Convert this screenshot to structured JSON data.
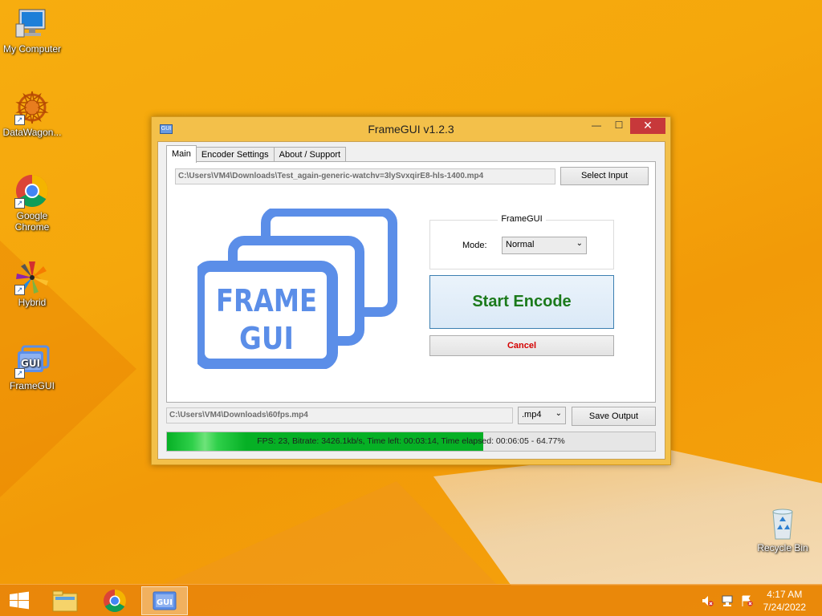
{
  "desktop": {
    "icons": [
      {
        "label": "My Computer"
      },
      {
        "label": "DataWagon..."
      },
      {
        "label": "Google Chrome"
      },
      {
        "label": "Hybrid"
      },
      {
        "label": "FrameGUI"
      },
      {
        "label": "Recycle Bin"
      }
    ]
  },
  "window": {
    "title": "FrameGUI v1.2.3",
    "icon_text": "GUI",
    "minimize": "—",
    "maximize": "☐",
    "close": "✕",
    "tabs": [
      {
        "label": "Main",
        "active": true
      },
      {
        "label": "Encoder Settings",
        "active": false
      },
      {
        "label": "About / Support",
        "active": false
      }
    ],
    "input_path": "C:\\Users\\VM4\\Downloads\\Test_again-generic-watchv=3lySvxqirE8-hls-1400.mp4",
    "select_input_label": "Select Input",
    "group_title": "FrameGUI",
    "mode_label": "Mode:",
    "mode_value": "Normal",
    "start_label": "Start Encode",
    "cancel_label": "Cancel",
    "logo_line1": "FRAME",
    "logo_line2": "GUI",
    "output_path": "C:\\Users\\VM4\\Downloads\\60fps.mp4",
    "format_value": ".mp4",
    "save_output_label": "Save Output",
    "progress_text": "FPS: 23, Bitrate: 3426.1kb/s, Time left: 00:03:14, Time elapsed: 00:06:05 - 64.77%",
    "progress_percent": 64.77
  },
  "taskbar": {
    "time": "4:17 AM",
    "date": "7/24/2022",
    "items": [
      "start",
      "file-explorer",
      "chrome",
      "framegui"
    ]
  },
  "colors": {
    "accent_green": "#06b025",
    "start_text": "#1b7a1b",
    "cancel_text": "#d40000",
    "logo_blue": "#5b8ee8"
  }
}
